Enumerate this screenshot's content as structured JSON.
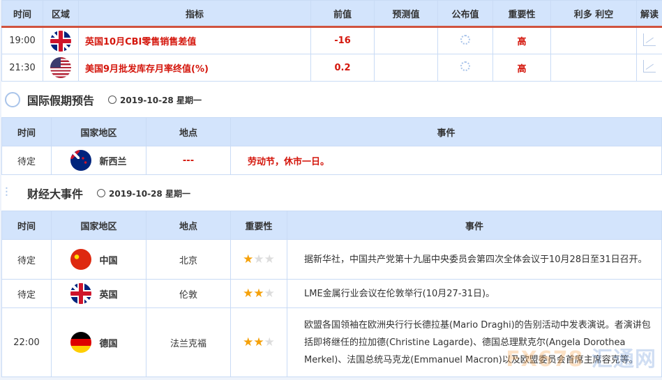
{
  "econ": {
    "headers": [
      "时间",
      "区域",
      "指标",
      "前值",
      "预测值",
      "公布值",
      "重要性",
      "利多 利空",
      "解读"
    ],
    "rows": [
      {
        "time": "19:00",
        "flag": "uk-flag",
        "indicator": "英国10月CBI零售销售差值",
        "previous": "-16",
        "forecast": "",
        "actual": "loading-icon",
        "importance": "高",
        "impact": ""
      },
      {
        "time": "21:30",
        "flag": "us-flag",
        "indicator": "美国9月批发库存月率终值(%)",
        "previous": "0.2",
        "forecast": "",
        "actual": "loading-icon",
        "importance": "高",
        "impact": ""
      }
    ]
  },
  "holiday": {
    "title": "国际假期预告",
    "date": "2019-10-28 星期一",
    "headers": [
      "时间",
      "国家地区",
      "地点",
      "事件"
    ],
    "rows": [
      {
        "time": "待定",
        "flag": "nz-flag",
        "country": "新西兰",
        "place": "---",
        "event": "劳动节，休市一日。"
      }
    ]
  },
  "events": {
    "title": "财经大事件",
    "date": "2019-10-28 星期一",
    "headers": [
      "时间",
      "国家地区",
      "地点",
      "重要性",
      "事件"
    ],
    "rows": [
      {
        "time": "待定",
        "flag": "cn-flag",
        "country": "中国",
        "place": "北京",
        "stars": 1,
        "event": "据新华社，中国共产党第十九届中央委员会第四次全体会议于10月28日至31日召开。"
      },
      {
        "time": "待定",
        "flag": "uk-flag",
        "country": "英国",
        "place": "伦敦",
        "stars": 2,
        "event": "LME金属行业会议在伦敦举行(10月27-31日)。"
      },
      {
        "time": "22:00",
        "flag": "de-flag",
        "country": "德国",
        "place": "法兰克福",
        "stars": 2,
        "event": "欧盟各国领袖在欧洲央行行长德拉基(Mario Draghi)的告别活动中发表演说。者演讲包括即将继任的拉加德(Christine Lagarde)、德国总理默克尔(Angela Dorothea Merkel)、法国总统马克龙(Emmanuel Macron)以及欧盟委员会首席主席容克等。"
      }
    ]
  },
  "watermark": {
    "a": "FX678",
    "b": "汇通网"
  },
  "colors": {
    "accent_red": "#d4160c",
    "header_bg": "#d3e4fc",
    "star": "#f5a10a"
  }
}
